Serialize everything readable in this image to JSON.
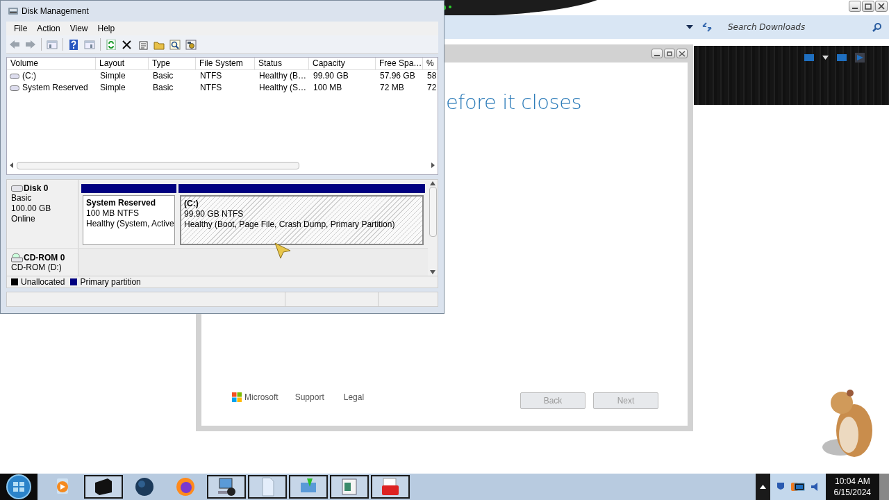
{
  "disk_management": {
    "title": "Disk Management",
    "menu": [
      "File",
      "Action",
      "View",
      "Help"
    ],
    "volume_table": {
      "columns": [
        "Volume",
        "Layout",
        "Type",
        "File System",
        "Status",
        "Capacity",
        "Free Spa…",
        "%"
      ],
      "rows": [
        {
          "cells": [
            "(C:)",
            "Simple",
            "Basic",
            "NTFS",
            "Healthy (B…",
            "99.90 GB",
            "57.96 GB",
            "58"
          ]
        },
        {
          "cells": [
            "System Reserved",
            "Simple",
            "Basic",
            "NTFS",
            "Healthy (S…",
            "100 MB",
            "72 MB",
            "72"
          ]
        }
      ]
    },
    "disks": [
      {
        "name": "Disk 0",
        "type": "Basic",
        "size": "100.00 GB",
        "status": "Online",
        "partitions": [
          {
            "name": "System Reserved",
            "size": "100 MB NTFS",
            "status": "Healthy (System, Active",
            "selected": false
          },
          {
            "name": "(C:)",
            "size": "99.90 GB NTFS",
            "status": "Healthy (Boot, Page File, Crash Dump, Primary Partition)",
            "selected": true
          }
        ]
      }
    ],
    "cdrom": {
      "name": "CD-ROM 0",
      "drive": "CD-ROM (D:)"
    },
    "legend": [
      {
        "label": "Unallocated",
        "color": "#000000"
      },
      {
        "label": "Primary partition",
        "color": "#000080"
      }
    ]
  },
  "explorer": {
    "search": {
      "placeholder": "Search Downloads"
    }
  },
  "setup": {
    "heading": "efore it closes",
    "brand": "Microsoft",
    "links": [
      "Support",
      "Legal"
    ],
    "buttons": [
      {
        "label": "Back",
        "disabled": true
      },
      {
        "label": "Next",
        "disabled": true
      }
    ]
  },
  "taskbar": {
    "apps": [
      {
        "running": false
      },
      {
        "running": true
      },
      {
        "running": false
      },
      {
        "running": false
      },
      {
        "running": true
      },
      {
        "running": true
      },
      {
        "running": true
      },
      {
        "running": true
      },
      {
        "running": true
      }
    ],
    "clock": {
      "time": "10:04 AM",
      "date": "6/15/2024"
    }
  }
}
